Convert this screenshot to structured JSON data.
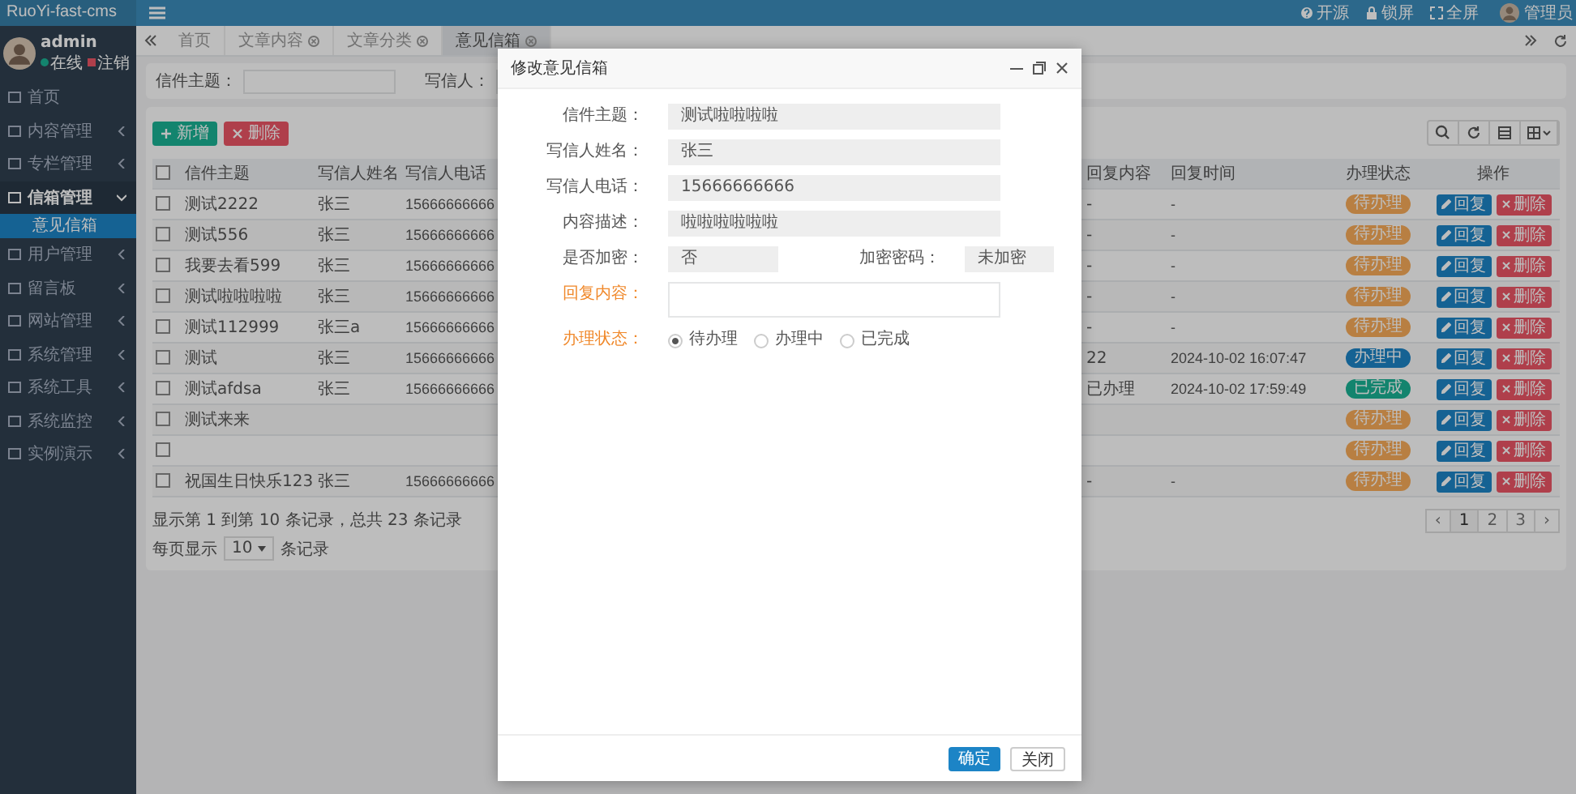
{
  "header": {
    "brand": "RuoYi-fast-cms",
    "actions": [
      {
        "label": "开源",
        "kind": "help"
      },
      {
        "label": "锁屏",
        "kind": "lock"
      },
      {
        "label": "全屏",
        "kind": "expand"
      }
    ],
    "user": "管理员"
  },
  "sidebar": {
    "user": {
      "name": "admin",
      "status": "在线",
      "logout": "注销"
    },
    "items": [
      {
        "label": "首页",
        "kind": "link"
      },
      {
        "label": "内容管理",
        "kind": "group",
        "expanded": false
      },
      {
        "label": "专栏管理",
        "kind": "group",
        "expanded": false
      },
      {
        "label": "信箱管理",
        "kind": "group",
        "expanded": true,
        "children": [
          {
            "label": "意见信箱",
            "selected": true
          }
        ]
      },
      {
        "label": "用户管理",
        "kind": "group",
        "expanded": false
      },
      {
        "label": "留言板",
        "kind": "group",
        "expanded": false
      },
      {
        "label": "网站管理",
        "kind": "group",
        "expanded": false
      },
      {
        "label": "系统管理",
        "kind": "group",
        "expanded": false
      },
      {
        "label": "系统工具",
        "kind": "group",
        "expanded": false
      },
      {
        "label": "系统监控",
        "kind": "group",
        "expanded": false
      },
      {
        "label": "实例演示",
        "kind": "group",
        "expanded": false
      }
    ]
  },
  "tabs": [
    {
      "label": "首页",
      "selected": false,
      "closable": false
    },
    {
      "label": "文章内容",
      "selected": false,
      "closable": true
    },
    {
      "label": "文章分类",
      "selected": false,
      "closable": true
    },
    {
      "label": "意见信箱",
      "selected": true,
      "closable": true
    }
  ],
  "search": {
    "fields": [
      {
        "label": "信件主题："
      },
      {
        "label": "写信人："
      }
    ]
  },
  "toolbar": [
    {
      "label": "新增",
      "kind": "add"
    },
    {
      "label": "删除",
      "kind": "remove"
    }
  ],
  "table": {
    "select_all_checked": false,
    "columns": [
      "信件主题",
      "写信人姓名",
      "写信人电话",
      "回复内容",
      "回复时间",
      "办理状态",
      "操作"
    ],
    "rows": [
      {
        "checked": false,
        "subject": "测试2222",
        "name": "张三",
        "phone": "15666666666",
        "reply": "-",
        "time": "-",
        "status": {
          "label": "待办理",
          "kind": "pending"
        },
        "actions": [
          {
            "label": "回复",
            "kind": "edit"
          },
          {
            "label": "删除",
            "kind": "remove"
          }
        ]
      },
      {
        "checked": false,
        "subject": "测试556",
        "name": "张三",
        "phone": "15666666666",
        "reply": "-",
        "time": "-",
        "status": {
          "label": "待办理",
          "kind": "pending"
        },
        "actions": [
          {
            "label": "回复",
            "kind": "edit"
          },
          {
            "label": "删除",
            "kind": "remove"
          }
        ]
      },
      {
        "checked": false,
        "subject": "我要去看599",
        "name": "张三",
        "phone": "15666666666",
        "reply": "-",
        "time": "-",
        "status": {
          "label": "待办理",
          "kind": "pending"
        },
        "actions": [
          {
            "label": "回复",
            "kind": "edit"
          },
          {
            "label": "删除",
            "kind": "remove"
          }
        ]
      },
      {
        "checked": false,
        "subject": "测试啦啦啦啦",
        "name": "张三",
        "phone": "15666666666",
        "reply": "-",
        "time": "-",
        "status": {
          "label": "待办理",
          "kind": "pending"
        },
        "actions": [
          {
            "label": "回复",
            "kind": "edit"
          },
          {
            "label": "删除",
            "kind": "remove"
          }
        ]
      },
      {
        "checked": false,
        "subject": "测试112999",
        "name": "张三a",
        "phone": "15666666666",
        "reply": "-",
        "time": "-",
        "status": {
          "label": "待办理",
          "kind": "pending"
        },
        "actions": [
          {
            "label": "回复",
            "kind": "edit"
          },
          {
            "label": "删除",
            "kind": "remove"
          }
        ]
      },
      {
        "checked": false,
        "subject": "测试",
        "name": "张三",
        "phone": "15666666666",
        "reply": "22",
        "time": "2024-10-02 16:07:47",
        "status": {
          "label": "办理中",
          "kind": "processing"
        },
        "actions": [
          {
            "label": "回复",
            "kind": "edit"
          },
          {
            "label": "删除",
            "kind": "remove"
          }
        ]
      },
      {
        "checked": false,
        "subject": "测试afdsa",
        "name": "张三",
        "phone": "15666666666",
        "reply": "已办理",
        "time": "2024-10-02 17:59:49",
        "status": {
          "label": "已完成",
          "kind": "done"
        },
        "actions": [
          {
            "label": "回复",
            "kind": "edit"
          },
          {
            "label": "删除",
            "kind": "remove"
          }
        ]
      },
      {
        "checked": false,
        "subject": "测试来来",
        "status": {
          "label": "待办理",
          "kind": "pending"
        },
        "actions": [
          {
            "label": "回复",
            "kind": "edit"
          },
          {
            "label": "删除",
            "kind": "remove"
          }
        ]
      },
      {
        "checked": false,
        "status": {
          "label": "待办理",
          "kind": "pending"
        },
        "actions": [
          {
            "label": "回复",
            "kind": "edit"
          },
          {
            "label": "删除",
            "kind": "remove"
          }
        ]
      },
      {
        "checked": false,
        "subject": "祝国生日快乐123",
        "name": "张三",
        "phone": "15666666666",
        "reply": "-",
        "time": "-",
        "status": {
          "label": "待办理",
          "kind": "pending"
        },
        "actions": [
          {
            "label": "回复",
            "kind": "edit"
          },
          {
            "label": "删除",
            "kind": "remove"
          }
        ]
      }
    ]
  },
  "footer": {
    "summary": "显示第 1 到第 10 条记录，总共 23 条记录",
    "per_page_label": "每页显示",
    "per_page": "10",
    "per_page_suffix": "条记录"
  },
  "pagination": {
    "prev": "‹",
    "pages": [
      {
        "label": "1",
        "selected": true
      },
      {
        "label": "2",
        "selected": false
      },
      {
        "label": "3",
        "selected": false
      }
    ],
    "next": "›"
  },
  "modal": {
    "title": "修改意见信箱",
    "rows": [
      {
        "fields": [
          {
            "kind": "input",
            "label": "信件主题：",
            "value": "测试啦啦啦啦",
            "required": false
          }
        ]
      },
      {
        "fields": [
          {
            "kind": "input",
            "label": "写信人姓名：",
            "value": "张三",
            "required": false
          }
        ]
      },
      {
        "fields": [
          {
            "kind": "input",
            "label": "写信人电话：",
            "value": "15666666666",
            "required": false
          }
        ]
      },
      {
        "fields": [
          {
            "kind": "input",
            "label": "内容描述：",
            "value": "啦啦啦啦啦啦",
            "required": false
          }
        ]
      },
      {
        "fields": [
          {
            "kind": "input",
            "label": "是否加密：",
            "value": "否",
            "required": false
          },
          {
            "kind": "input",
            "label": "加密密码：",
            "value": "未加密",
            "required": false
          }
        ]
      },
      {
        "fields": [
          {
            "kind": "textarea",
            "label": "回复内容：",
            "required": true
          }
        ]
      },
      {
        "fields": [
          {
            "kind": "radio",
            "label": "办理状态：",
            "required": true,
            "options": [
              {
                "label": "待办理",
                "selected": true
              },
              {
                "label": "办理中",
                "selected": false
              },
              {
                "label": "已完成",
                "selected": false
              }
            ]
          }
        ]
      }
    ],
    "buttons": [
      {
        "label": "确定",
        "kind": "primary"
      },
      {
        "label": "关闭",
        "kind": "default"
      }
    ]
  }
}
